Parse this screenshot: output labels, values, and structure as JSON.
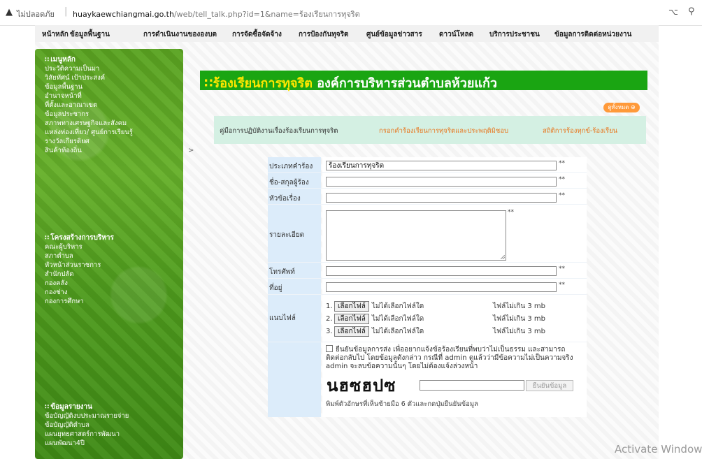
{
  "browser": {
    "security_text": "ไม่ปลอดภัย",
    "url_domain": "huaykaewchiangmai.go.th",
    "url_path": "/web/tell_talk.php?id=1&name=ร้องเรียนการทุจริต"
  },
  "topnav": {
    "items": [
      "หน้าหลัก",
      "ข้อมูลพื้นฐาน",
      "การดำเนินงานขององบต",
      "การจัดซื้อจัดจ้าง",
      "การป้องกันทุจริต",
      "ศูนย์ข้อมูลข่าวสาร",
      "ดาวน์โหลด",
      "บริการประชาชน",
      "ข้อมูลการติดต่อหน่วยงาน"
    ]
  },
  "sidebar": {
    "main_menu": {
      "heading": "เมนูหลัก",
      "items": [
        "ประวัติความเป็นมา",
        "วิสัยทัศน์ เป้าประสงค์",
        "ข้อมูลพื้นฐาน",
        "อำนาจหน้าที่",
        "ที่ตั้งและอาณาเขต",
        "ข้อมูลประชากร",
        "สภาพทางเศรษฐกิจและสังคม",
        "แหล่งท่องเที่ยว/ ศูนย์การเรียนรู้",
        "รางวัลเกียรติยศ",
        "สินค้าท้องถิ่น"
      ]
    },
    "structure": {
      "heading": "โครงสร้างการบริหาร",
      "items": [
        "คณะผู้บริหาร",
        "สภาตำบล",
        "หัวหน้าส่วนราชการ",
        "สำนักปลัด",
        "กองคลัง",
        "กองช่าง",
        "กองการศึกษา"
      ]
    },
    "reports": {
      "heading": "ข้อมูลรายงาน",
      "items": [
        "ข้อบัญญัติงบประมาณรายจ่าย",
        "ข้อบัญญัติตำบล",
        "แผนยุทธศาสตร์การพัฒนา",
        "แผนพัฒนา4ปี"
      ]
    }
  },
  "page": {
    "title_highlight": "ร้องเรียนการทุจริต",
    "title_rest": " องค์การบริหารส่วนตำบลห้วยแก้ว",
    "all_button": "ดูทั้งหมด",
    "tabs": [
      "คู่มือการปฏิบัติงานเรื่องร้องเรียนการทุจริต",
      "กรอกคำร้องเรียนการทุจริตและประพฤติมิชอบ",
      "สถิติการร้องทุกข์-ร้องเรียน"
    ]
  },
  "form": {
    "type_label": "ประเภทคำร้อง",
    "type_value": "ร้องเรียนการทุจริต",
    "name_label": "ชื่อ-สกุลผู้ร้อง",
    "subject_label": "หัวข้อเรื่อง",
    "detail_label": "รายละเอียด",
    "phone_label": "โทรศัพท์",
    "address_label": "ที่อยู่",
    "attach_label": "แนบไฟล์",
    "required_mark": "**",
    "files": [
      {
        "num": "1.",
        "button": "เลือกไฟล์",
        "status": "ไม่ได้เลือกไฟล์ใด",
        "limit": "ไฟล์ไม่เกิน 3 mb"
      },
      {
        "num": "2.",
        "button": "เลือกไฟล์",
        "status": "ไม่ได้เลือกไฟล์ใด",
        "limit": "ไฟล์ไม่เกิน 3 mb"
      },
      {
        "num": "3.",
        "button": "เลือกไฟล์",
        "status": "ไม่ได้เลือกไฟล์ใด",
        "limit": "ไฟล์ไม่เกิน 3 mb"
      }
    ],
    "confirm_text": "ยืนยันข้อมูลการส่ง เพื่ออยากแจ้งข้อร้องเรียนที่พบว่าไม่เป็นธรรม และสามารถติดต่อกลับไป โดยข้อมูลดังกล่าว กรณีที่ admin ดูแล้วว่ามีข้อความไม่เป็นความจริง admin จะลบข้อความนั้นๆ โดยไม่ต้องแจ้งล่วงหน้า",
    "captcha_text": "นฮซฮปซ",
    "captcha_button": "ยืนยันข้อมูล",
    "captcha_hint": "พิมพ์ตัวอักษรที่เห็นซ้ายมือ 6 ตัวและกดปุ่มยืนยันข้อมูล"
  },
  "watermark": "Activate Window"
}
